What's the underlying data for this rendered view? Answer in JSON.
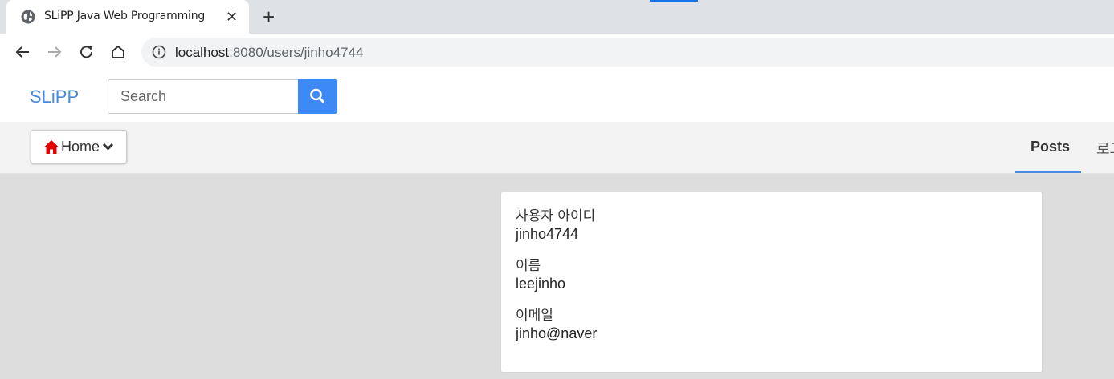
{
  "browser": {
    "tab_title": "SLiPP Java Web Programming",
    "tab_close": "✕",
    "new_tab": "+",
    "url_host": "localhost",
    "url_rest": ":8080/users/jinho4744"
  },
  "header": {
    "brand": "SLiPP",
    "search_placeholder": "Search"
  },
  "subnav": {
    "home_label": "Home",
    "posts_label": "Posts",
    "login_label": "로그"
  },
  "profile": {
    "fields": [
      {
        "label": "사용자 아이디",
        "value": "jinho4744"
      },
      {
        "label": "이름",
        "value": "leejinho"
      },
      {
        "label": "이메일",
        "value": "jinho@naver"
      }
    ]
  },
  "colors": {
    "brand": "#4a89dc",
    "search_button": "#3d8af7",
    "home_icon": "#e00000"
  }
}
